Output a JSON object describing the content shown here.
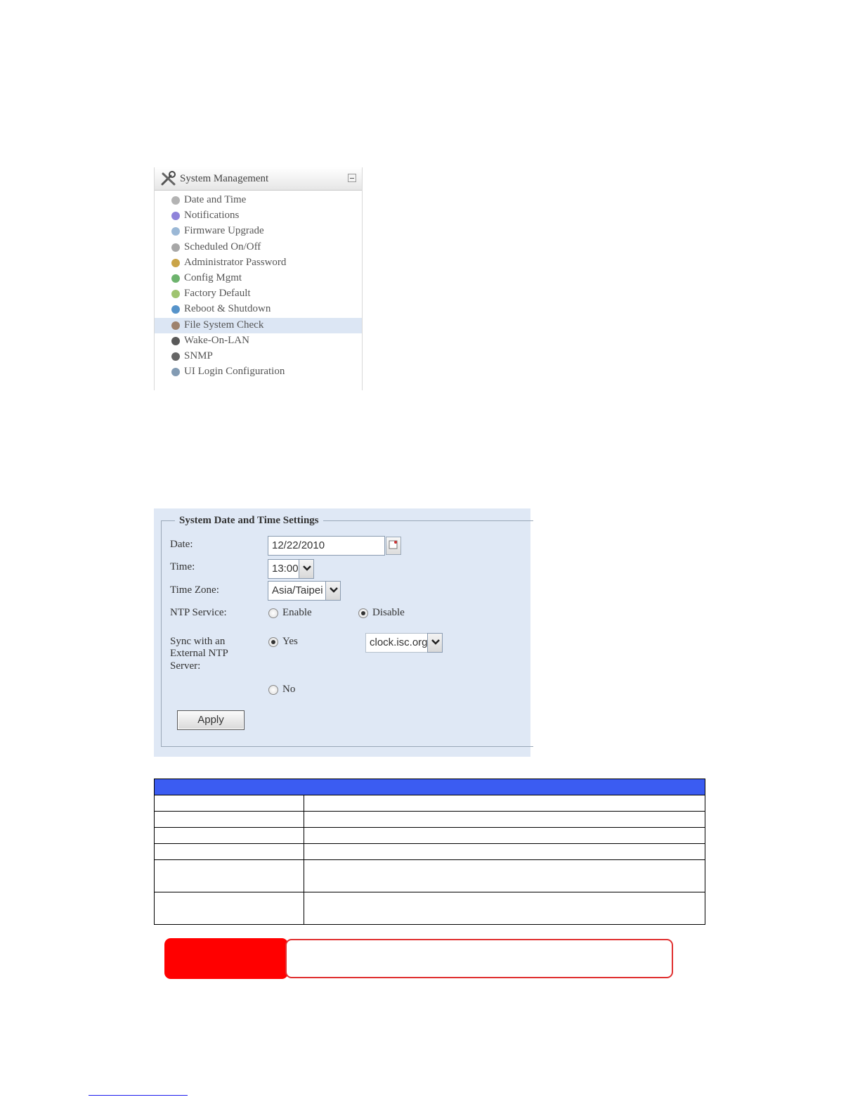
{
  "menu": {
    "title": "System Management",
    "items": [
      {
        "label": "Date and Time",
        "icon": "clock-icon"
      },
      {
        "label": "Notifications",
        "icon": "notification-icon"
      },
      {
        "label": "Firmware Upgrade",
        "icon": "firmware-icon"
      },
      {
        "label": "Scheduled On/Off",
        "icon": "schedule-icon"
      },
      {
        "label": "Administrator Password",
        "icon": "admin-user-icon"
      },
      {
        "label": "Config Mgmt",
        "icon": "config-icon"
      },
      {
        "label": "Factory Default",
        "icon": "factory-default-icon"
      },
      {
        "label": "Reboot & Shutdown",
        "icon": "power-icon"
      },
      {
        "label": "File System Check",
        "icon": "disk-check-icon",
        "selected": true
      },
      {
        "label": "Wake-On-LAN",
        "icon": "wake-on-lan-icon"
      },
      {
        "label": "SNMP",
        "icon": "network-icon"
      },
      {
        "label": "UI Login Configuration",
        "icon": "login-config-icon"
      }
    ]
  },
  "settings": {
    "legend": "System Date and Time Settings",
    "date_label": "Date:",
    "date_value": "12/22/2010",
    "time_label": "Time:",
    "time_value": "13:00",
    "timezone_label": "Time Zone:",
    "timezone_value": "Asia/Taipei",
    "ntp_label": "NTP Service:",
    "ntp_enable": "Enable",
    "ntp_disable": "Disable",
    "ntp_selected": "Disable",
    "sync_label_1": "Sync with an",
    "sync_label_2": "External NTP",
    "sync_label_3": "Server:",
    "sync_yes": "Yes",
    "sync_no": "No",
    "sync_selected": "Yes",
    "ntp_server_value": "clock.isc.org",
    "apply_label": "Apply"
  },
  "colors": {
    "table_header": "#3b5cf2",
    "note_tag": "#ff0000",
    "note_border": "#e03030",
    "panel_bg": "#dfe8f5"
  }
}
